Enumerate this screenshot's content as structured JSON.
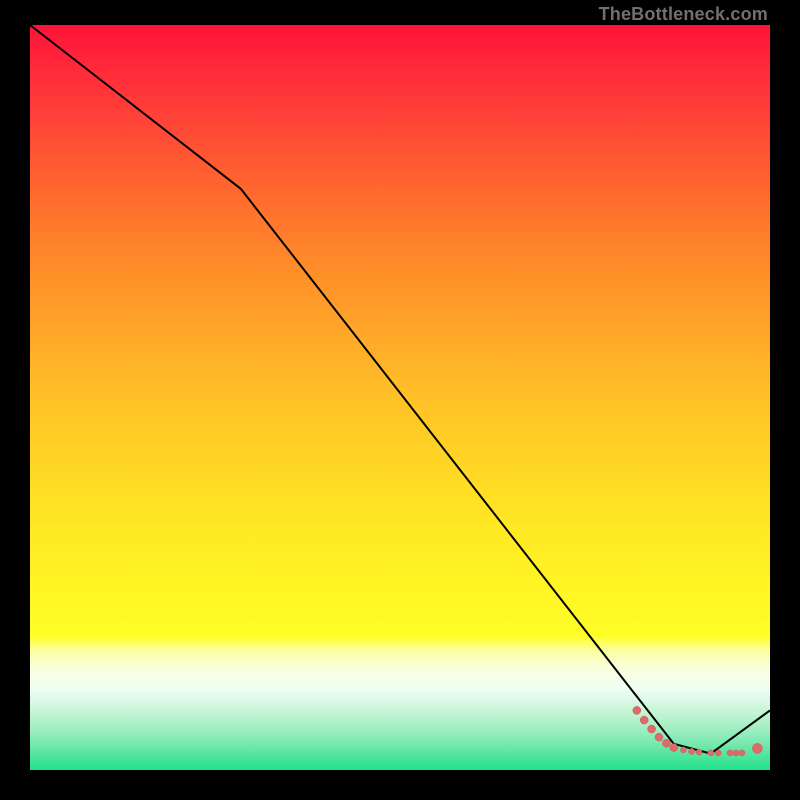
{
  "watermark": "TheBottleneck.com",
  "colors": {
    "line": "#000000",
    "marker_fill": "#e06a6a",
    "marker_stroke": "#c85858"
  },
  "chart_data": {
    "type": "line",
    "title": "",
    "xlabel": "",
    "ylabel": "",
    "xlim": [
      0,
      100
    ],
    "ylim": [
      0,
      100
    ],
    "grid": false,
    "legend": false,
    "comment": "Axes have no visible numeric tick labels in the screenshot; x/y values below use percentage of plot width/height as a proxy scale.",
    "series": [
      {
        "name": "curve",
        "x_pct": [
          0,
          28.5,
          87,
          92,
          100
        ],
        "y_pct": [
          100,
          78,
          3.5,
          2.2,
          8
        ]
      }
    ],
    "markers": {
      "name": "bottom-cluster",
      "comment": "Small salmon dots and short dashed segments near the curve's valley; approximate x positions in % of plot width, all at roughly y≈2–4%. Sizes are approximate screen radii in px.",
      "points": [
        {
          "x_pct": 82.0,
          "y_pct": 8.0,
          "r": 4
        },
        {
          "x_pct": 83.0,
          "y_pct": 6.7,
          "r": 4
        },
        {
          "x_pct": 84.0,
          "y_pct": 5.5,
          "r": 4
        },
        {
          "x_pct": 85.0,
          "y_pct": 4.4,
          "r": 4
        },
        {
          "x_pct": 86.0,
          "y_pct": 3.6,
          "r": 4
        },
        {
          "x_pct": 87.0,
          "y_pct": 3.0,
          "r": 4
        },
        {
          "x_pct": 88.3,
          "y_pct": 2.7,
          "r": 3
        },
        {
          "x_pct": 89.4,
          "y_pct": 2.5,
          "r": 3
        },
        {
          "x_pct": 90.4,
          "y_pct": 2.4,
          "r": 3
        },
        {
          "x_pct": 92.0,
          "y_pct": 2.3,
          "r": 3
        },
        {
          "x_pct": 93.0,
          "y_pct": 2.3,
          "r": 3
        },
        {
          "x_pct": 94.6,
          "y_pct": 2.3,
          "r": 3
        },
        {
          "x_pct": 95.4,
          "y_pct": 2.3,
          "r": 3
        },
        {
          "x_pct": 96.2,
          "y_pct": 2.3,
          "r": 3
        },
        {
          "x_pct": 98.3,
          "y_pct": 2.9,
          "r": 5
        }
      ]
    }
  }
}
